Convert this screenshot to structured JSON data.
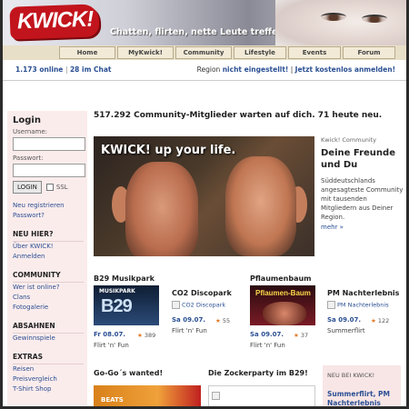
{
  "header": {
    "logo": "KWICK!",
    "tagline": "Chatten, flirten, nette Leute treffen."
  },
  "nav": [
    "Home",
    "MyKwick!",
    "Community",
    "Lifestyle",
    "Events",
    "Forum"
  ],
  "status": {
    "online": "1.173 online",
    "chat": "28 im Chat",
    "region_prefix": "Region",
    "region_value": "nicht eingestellt!",
    "signup": "Jetzt kostenlos anmelden!"
  },
  "sidebar": {
    "login_title": "Login",
    "username_label": "Username:",
    "password_label": "Passwort:",
    "login_button": "LOGIN",
    "ssl_label": "SSL",
    "register": "Neu registrieren",
    "forgot": "Passwort?",
    "sections": [
      {
        "title": "NEU HIER?",
        "links": [
          "Über KWICK!",
          "Anmelden"
        ]
      },
      {
        "title": "COMMUNITY",
        "links": [
          "Wer ist online?",
          "Clans",
          "Fotogalerie"
        ]
      },
      {
        "title": "ABSAHNEN",
        "links": [
          "Gewinnspiele"
        ]
      },
      {
        "title": "EXTRAS",
        "links": [
          "Reisen",
          "Preisvergleich",
          "T-Shirt Shop"
        ]
      }
    ]
  },
  "main": {
    "headline": "517.292 Community-Mitglieder warten auf dich. 71 heute neu.",
    "banner": "KWICK! up your life.",
    "side_kicker": "Kwick! Community",
    "side_title": "Deine Freunde und Du",
    "side_text": "Süddeutschlands angesagteste Community mit tausenden Mitgliedern aus Deiner Region.",
    "side_more": "mehr »"
  },
  "events": [
    {
      "title": "B29 Musikpark",
      "thumb_text": "B29",
      "thumb_sub": "MUSIKPARK",
      "date": "Fr 08.07.",
      "count": "389",
      "sub": "Flirt 'n' Fun"
    },
    {
      "title": "CO2 Discopark",
      "broken": "CO2 Discopark",
      "date": "Sa 09.07.",
      "count": "55",
      "sub": "Flirt 'n' Fun"
    },
    {
      "title": "Pflaumenbaum",
      "thumb_text": "Pflaumen-Baum",
      "date": "Sa 09.07.",
      "count": "37",
      "sub": "Flirt 'n' Fun"
    },
    {
      "title": "PM Nachterlebnis",
      "broken": "PM Nachterlebnis",
      "date": "Sa 09.07.",
      "count": "122",
      "sub": "Summerflirt"
    }
  ],
  "bottom": {
    "gogo_title": "Go-Go´s wanted!",
    "gogo_thumb": "BEATS",
    "zocker_title": "Die Zockerparty im B29!",
    "neu_kicker": "NEU BEI KWICK!",
    "neu_link": "Summerflirt, PM Nachterlebnis"
  },
  "colors": {
    "brand": "#c2141c",
    "link": "#2a4f93",
    "sidebar_bg": "#fbecec"
  }
}
